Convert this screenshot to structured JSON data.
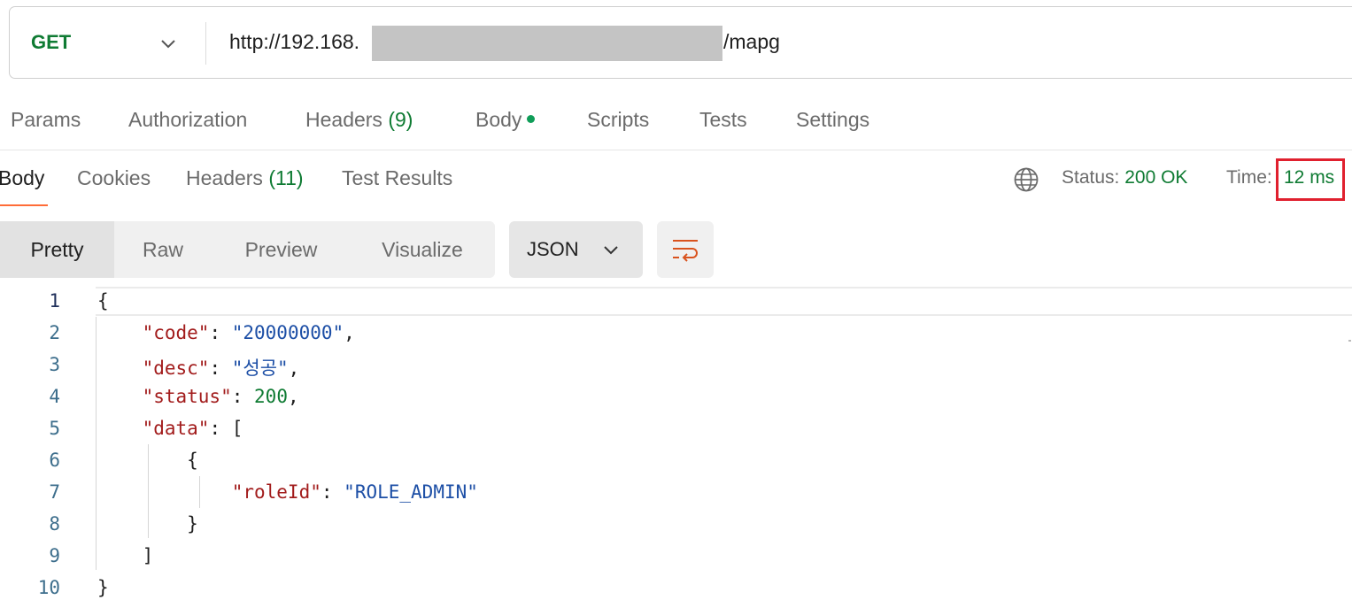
{
  "request": {
    "method": "GET",
    "url_prefix": "http://192.168.",
    "url_suffix": "/mapg"
  },
  "request_tabs": {
    "params": "Params",
    "authorization": "Authorization",
    "headers": "Headers",
    "headers_count": "(9)",
    "body": "Body",
    "scripts": "Scripts",
    "tests": "Tests",
    "settings": "Settings"
  },
  "response_tabs": {
    "body": "Body",
    "cookies": "Cookies",
    "headers": "Headers",
    "headers_count": "(11)",
    "test_results": "Test Results"
  },
  "response_meta": {
    "status_label": "Status:",
    "status_value": "200 OK",
    "time_label": "Time:",
    "time_value": "12 ms"
  },
  "format_bar": {
    "pretty": "Pretty",
    "raw": "Raw",
    "preview": "Preview",
    "visualize": "Visualize",
    "language": "JSON"
  },
  "code": {
    "line_numbers": [
      "1",
      "2",
      "3",
      "4",
      "5",
      "6",
      "7",
      "8",
      "9",
      "10"
    ],
    "tokens": {
      "open_brace": "{",
      "code_key": "\"code\"",
      "code_value": "\"20000000\"",
      "desc_key": "\"desc\"",
      "desc_value": "\"성공\"",
      "status_key": "\"status\"",
      "status_value": "200",
      "data_key": "\"data\"",
      "open_bracket": "[",
      "inner_open": "{",
      "role_key": "\"roleId\"",
      "role_value": "\"ROLE_ADMIN\"",
      "inner_close": "}",
      "close_bracket": "]",
      "close_brace": "}"
    }
  },
  "colors": {
    "accent": "#ff6c37",
    "success": "#0f7b33",
    "highlight": "#e0202e"
  }
}
